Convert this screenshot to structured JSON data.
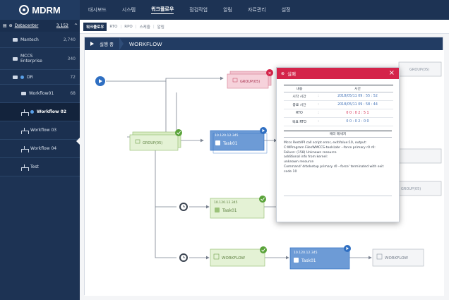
{
  "brand": {
    "name": "MDRM"
  },
  "nav": [
    "대시보드",
    "시스템",
    "워크플로우",
    "점검작업",
    "알림",
    "자료관리",
    "설정"
  ],
  "nav_active_index": 2,
  "subnav": {
    "active": "워크플로우",
    "items": [
      "RTO",
      "RPO",
      "스케줄",
      "알림"
    ]
  },
  "sidebar": {
    "datacenter": {
      "label": "Datacenter",
      "count": "3,152"
    },
    "items": [
      {
        "label": "Mantech",
        "value": "2,740"
      },
      {
        "label": "MCCS Enterprise",
        "value": "340"
      },
      {
        "label": "DR",
        "value": "72"
      }
    ],
    "workflows": [
      {
        "label": "Workflow01",
        "value": "68"
      },
      {
        "label": "Workflow 02"
      },
      {
        "label": "Workflow 03"
      },
      {
        "label": "Workflow 04"
      },
      {
        "label": "Test"
      }
    ]
  },
  "panel": {
    "status": "실행 중",
    "title": "WORKFLOW"
  },
  "nodes": {
    "group_top": "GROUP(05)",
    "group_right_top": "GROUP(05)",
    "group_main": "GROUP(05)",
    "group_right_mid": "GROUP(05)",
    "task1": {
      "ip": "10.120.12.345",
      "name": "Task01"
    },
    "task2": {
      "ip": "10.120.12.345",
      "name": "Task01"
    },
    "task3": {
      "ip": "10.120.12.345",
      "name": "Task01"
    },
    "workflow_mid": "WORKFLOW",
    "workflow_end": "WORKFLOW"
  },
  "popup": {
    "title": "실패",
    "col_label": "내용",
    "col_time": "시간",
    "rows": [
      {
        "label": "시작 시간",
        "value": "2018/05/11   09 : 55 : 52",
        "red": false
      },
      {
        "label": "종료 시간",
        "value": "2018/05/11   09 : 58 : 44",
        "red": false
      },
      {
        "label": "RTO",
        "value": "0 0 : 0 2 : 5 1",
        "red": true
      },
      {
        "label": "목표 RTO",
        "value": "0 0 : 0 2 : 0 0",
        "red": false
      }
    ],
    "message_title": "에러 메세지",
    "message": "Mccs RestAPI call script error, exitValue:10, output:\nC:WProgram FilesWMCCS-tools\\obr --force primary r0 r0:\nFailure: (158) Unknown resource\nadditional info from kernel:\nunknown resource\nCommand 'drbdsetup primary r0 --force' terminated with exit\ncode 10"
  },
  "colors": {
    "sidebar": "#1d3354",
    "group_green": "#d9ecc4",
    "task_blue": "#5b8fd0",
    "group_red": "#f2c3cf",
    "alert_red": "#d4244a"
  }
}
